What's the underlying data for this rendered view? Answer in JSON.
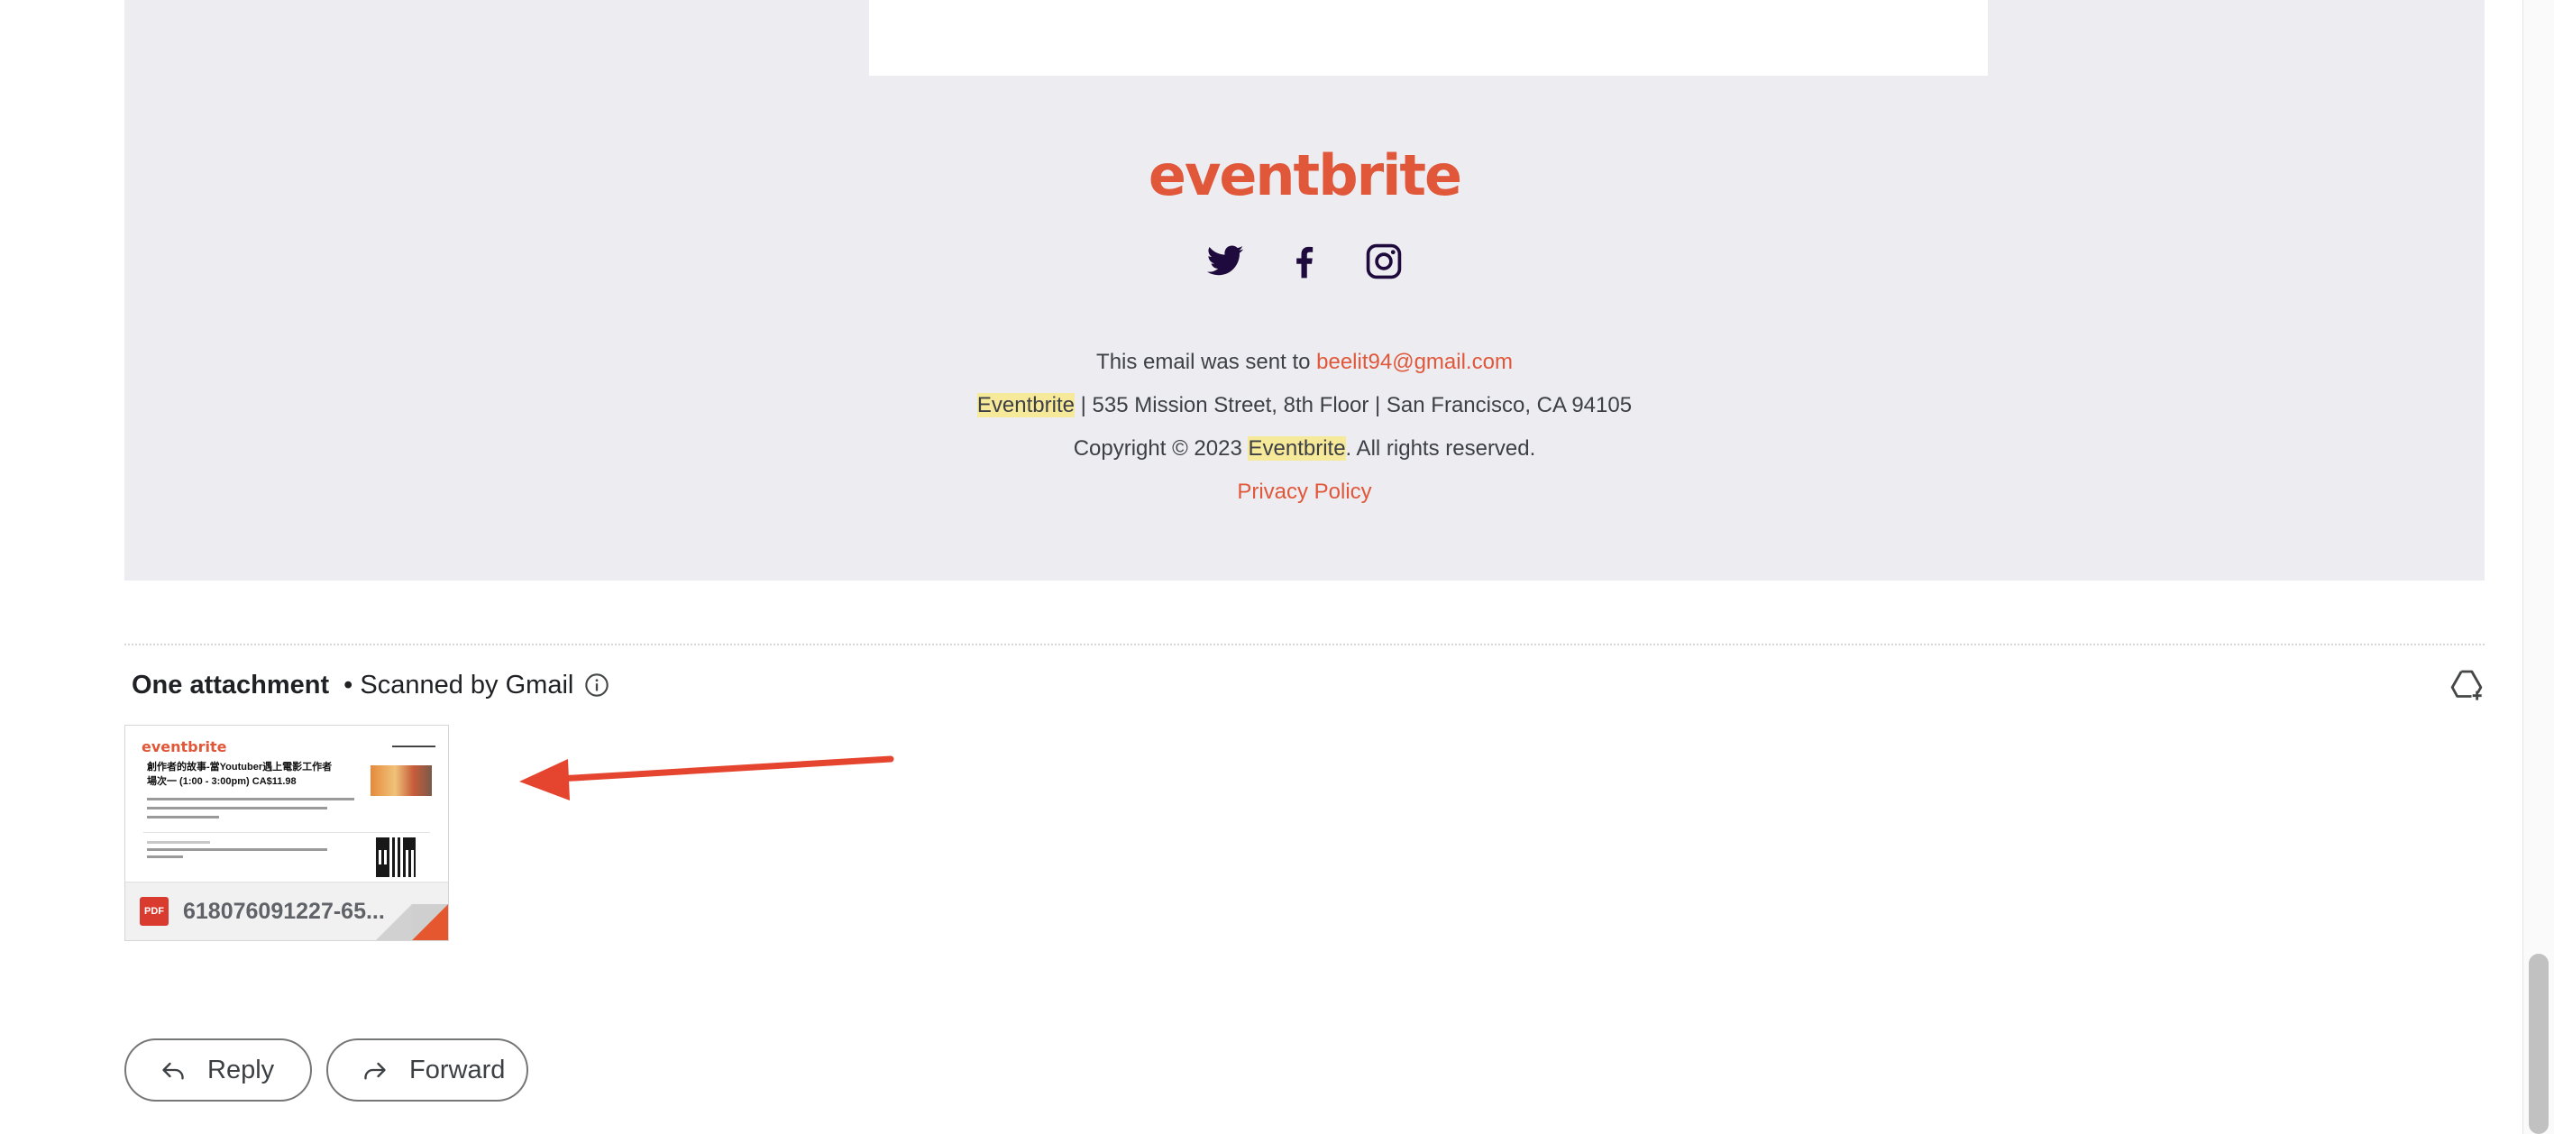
{
  "footer": {
    "logo_text": "eventbrite",
    "social": [
      "twitter-icon",
      "facebook-icon",
      "instagram-icon"
    ],
    "sent_prefix": "This email was sent to ",
    "sent_email": "beelit94@gmail.com",
    "company": "Eventbrite",
    "address": " | 535 Mission Street, 8th Floor | San Francisco, CA 94105",
    "copyright_prefix": "Copyright © 2023 ",
    "copyright_company": "Eventbrite",
    "copyright_suffix": ". All rights reserved.",
    "privacy": "Privacy Policy",
    "brand_color": "#e0573a",
    "highlight_color": "#f6e99a"
  },
  "attachments": {
    "title": "One attachment",
    "scanned": "• Scanned by Gmail",
    "file": {
      "name": "618076091227-65...",
      "type": "PDF",
      "preview_logo": "eventbrite",
      "preview_title": "創作者的故事-當Youtuber遇上電影工作者",
      "preview_subtitle": "場次一 (1:00 - 3:00pm) CA$11.98"
    }
  },
  "actions": {
    "reply": "Reply",
    "forward": "Forward"
  },
  "annotation": {
    "arrow_color": "#e5452f"
  }
}
